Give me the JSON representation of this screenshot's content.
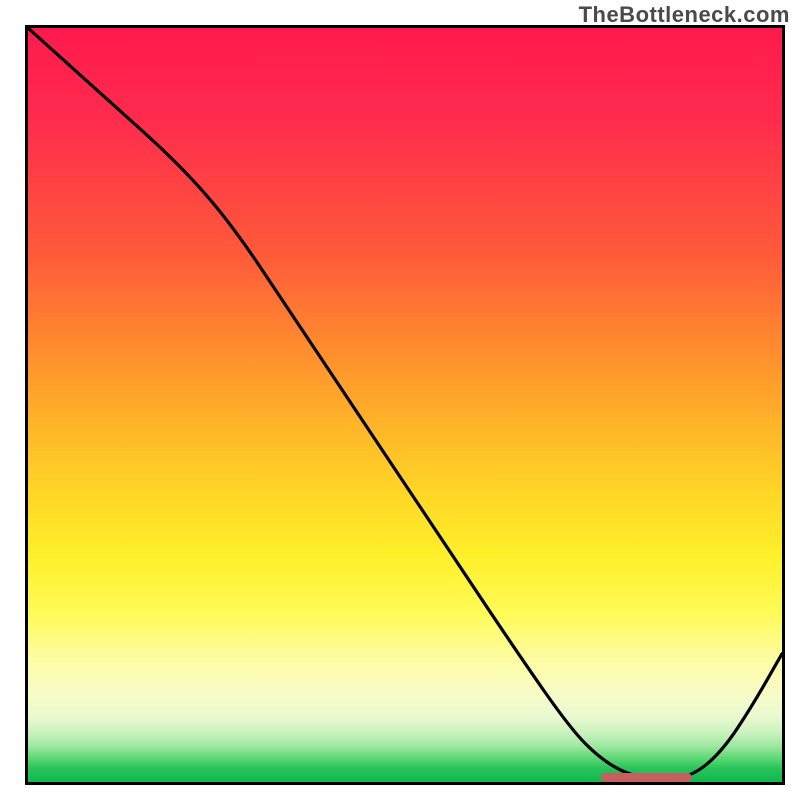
{
  "watermark_text": "TheBottleneck.com",
  "chart_data": {
    "type": "line",
    "title": "",
    "xlabel": "",
    "ylabel": "",
    "xlim": [
      0,
      100
    ],
    "ylim": [
      0,
      100
    ],
    "gradient_meaning": "background_gradient_top_red_to_bottom_green_indicating_bottleneck_severity",
    "series": [
      {
        "name": "bottleneck-curve",
        "x": [
          0,
          10,
          20,
          27,
          35,
          45,
          55,
          65,
          72,
          76,
          80,
          84,
          88,
          92,
          96,
          100
        ],
        "y": [
          100,
          91,
          82,
          74,
          62,
          47,
          32,
          17,
          7,
          3,
          0.8,
          0.4,
          0.7,
          4,
          10,
          17
        ]
      }
    ],
    "optimum_band": {
      "x_start": 76,
      "x_end": 88,
      "y": 0.6
    },
    "colors": {
      "curve": "#000000",
      "border": "#000000",
      "optimum_marker": "#c66060",
      "gradient_top": "#ff1a4d",
      "gradient_bottom": "#0fb84e"
    }
  }
}
